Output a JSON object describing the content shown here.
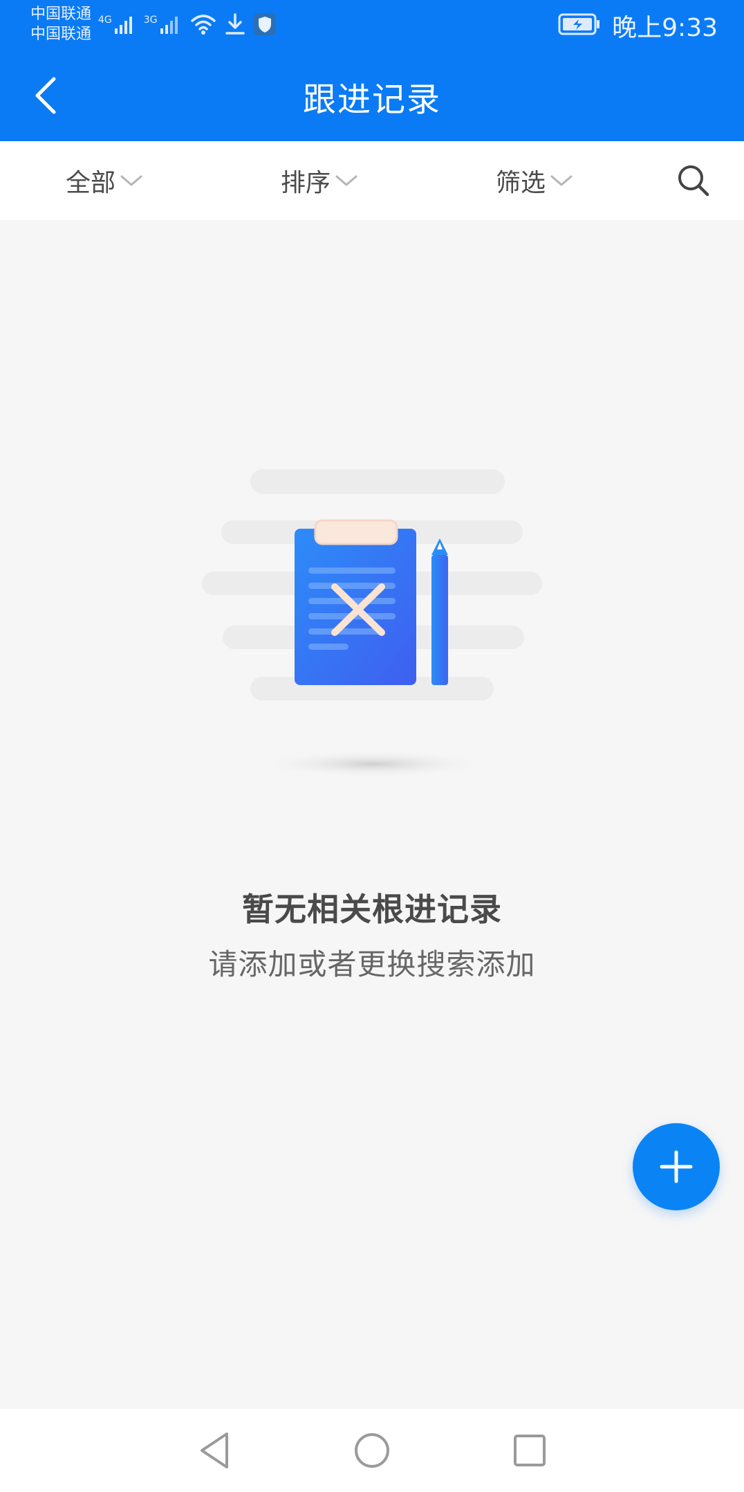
{
  "status_bar": {
    "carrier_1": "中国联通",
    "carrier_2": "中国联通",
    "network_1": "4G",
    "network_2": "3G",
    "time": "晚上9:33"
  },
  "header": {
    "title": "跟进记录",
    "back_icon": "chevron-left-icon"
  },
  "filters": [
    {
      "label": "全部",
      "icon": "chevron-down-icon"
    },
    {
      "label": "排序",
      "icon": "chevron-down-icon"
    },
    {
      "label": "筛选",
      "icon": "chevron-down-icon"
    }
  ],
  "search": {
    "icon": "search-icon"
  },
  "empty_state": {
    "title": "暂无相关根进记录",
    "subtitle": "请添加或者更换搜索添加"
  },
  "fab": {
    "icon": "plus-icon"
  },
  "system_nav": {
    "back": "triangle-back-icon",
    "home": "circle-home-icon",
    "recent": "square-recent-icon"
  },
  "colors": {
    "primary": "#0a7bf5",
    "background": "#f6f6f6",
    "text_dark": "#4a4a4a",
    "text_muted": "#666666"
  }
}
